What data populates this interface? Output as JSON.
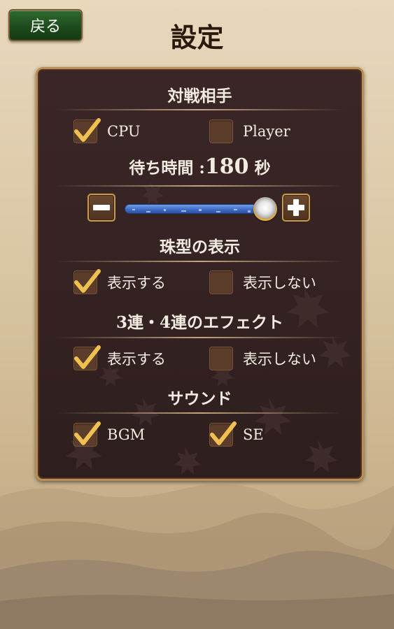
{
  "header": {
    "back_label": "戻る",
    "title": "設定"
  },
  "opponent": {
    "heading": "対戦相手",
    "options": [
      {
        "label": "CPU",
        "checked": true
      },
      {
        "label": "Player",
        "checked": false
      }
    ]
  },
  "wait_time": {
    "label": "待ち時間 :",
    "value": "180",
    "unit": "秒",
    "slider_level": 0.92,
    "minus_icon": "minus-icon",
    "plus_icon": "plus-icon"
  },
  "bead_type": {
    "heading": "珠型の表示",
    "options": [
      {
        "label": "表示する",
        "checked": true
      },
      {
        "label": "表示しない",
        "checked": false
      }
    ]
  },
  "combo_effect": {
    "heading": "3連・4連のエフェクト",
    "options": [
      {
        "label": "表示する",
        "checked": true
      },
      {
        "label": "表示しない",
        "checked": false
      }
    ]
  },
  "sound": {
    "heading": "サウンド",
    "options": [
      {
        "label": "BGM",
        "checked": true
      },
      {
        "label": "SE",
        "checked": true
      }
    ]
  },
  "colors": {
    "panel": "#342222",
    "check": "#f0c050",
    "button_green": "#1c4a1c",
    "slider_blue": "#3e6ac4"
  }
}
